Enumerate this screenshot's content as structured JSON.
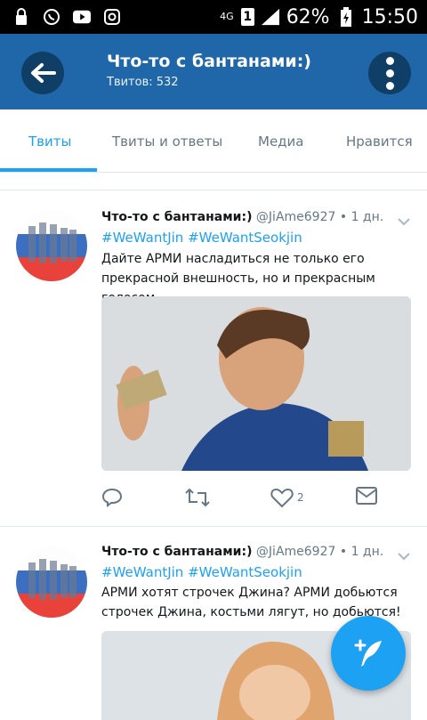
{
  "status_bar": {
    "network": "4G",
    "sim": "1",
    "battery": "62%",
    "time": "15:50"
  },
  "header": {
    "title": "Что-то с бантанами:)",
    "subtitle": "Твитов: 532"
  },
  "tabs": [
    {
      "label": "Твиты",
      "active": true
    },
    {
      "label": "Твиты и ответы",
      "active": false
    },
    {
      "label": "Медиа",
      "active": false
    },
    {
      "label": "Нравится",
      "active": false
    }
  ],
  "tweets": [
    {
      "name": "Что-то с бантанами:)",
      "handle": "@JiAme6927",
      "time": "• 1 дн.",
      "hashtags": "#WeWantJin #WeWantSeokjin",
      "text": "Дайте АРМИ насладиться не только его прекрасной внешность, но и прекрасным голосом",
      "likes": "2"
    },
    {
      "name": "Что-то с бантанами:)",
      "handle": "@JiAme6927",
      "time": "• 1 дн.",
      "hashtags": "#WeWantJin #WeWantSeokjin",
      "text": "АРМИ хотят строчек Джина? АРМИ добьются строчек Джина, костьми лягут, но добьются!"
    }
  ],
  "colors": {
    "app_bar": "#1f67a8",
    "accent": "#1da1f2"
  }
}
